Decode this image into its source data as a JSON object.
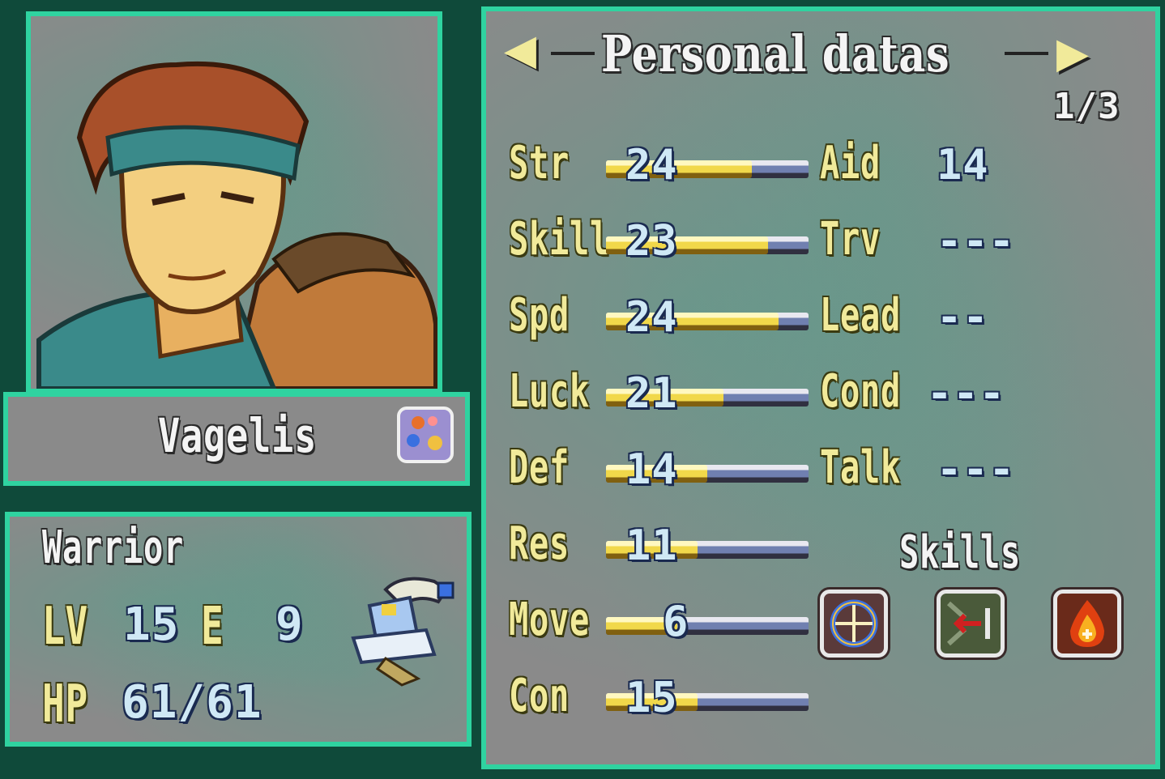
{
  "header": {
    "title": "Personal datas",
    "page": "1/3",
    "prev_arrow": "◀",
    "next_arrow": "▶"
  },
  "unit": {
    "name": "Vagelis",
    "class": "Warrior",
    "level_label": "LV",
    "level": "15",
    "exp_label": "E",
    "exp": "9",
    "hp_label": "HP",
    "hp": "61/61",
    "affinity_icon": "affinity-gem-icon"
  },
  "stats": [
    {
      "label": "Str",
      "value": "24",
      "bar_fill": 0.72
    },
    {
      "label": "Skill",
      "value": "23",
      "bar_fill": 0.8
    },
    {
      "label": "Spd",
      "value": "24",
      "bar_fill": 0.85
    },
    {
      "label": "Luck",
      "value": "21",
      "bar_fill": 0.58
    },
    {
      "label": "Def",
      "value": "14",
      "bar_fill": 0.5
    },
    {
      "label": "Res",
      "value": "11",
      "bar_fill": 0.45
    },
    {
      "label": "Move",
      "value": "6",
      "bar_fill": 0.35
    },
    {
      "label": "Con",
      "value": "15",
      "bar_fill": 0.45
    }
  ],
  "info": [
    {
      "label": "Aid",
      "value": "14"
    },
    {
      "label": "Trv",
      "value": "---"
    },
    {
      "label": "Lead",
      "value": "--"
    },
    {
      "label": "Cond",
      "value": "---"
    },
    {
      "label": "Talk",
      "value": "---"
    }
  ],
  "skills_label": "Skills",
  "skills": [
    "crosshair-shield-icon",
    "retreat-arrow-icon",
    "flame-icon"
  ],
  "colors": {
    "border": "#2fd3a0",
    "panel": "#8a8a8a",
    "label": "#f1ea9a",
    "number": "#cfe8f5"
  }
}
